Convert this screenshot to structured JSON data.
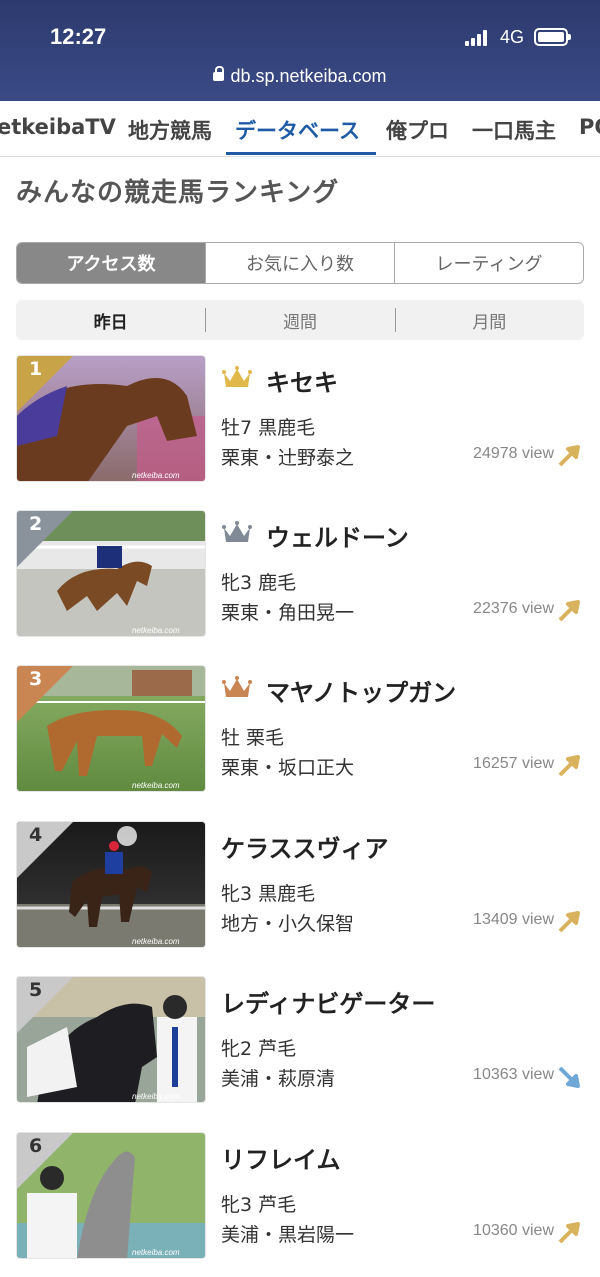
{
  "status": {
    "time": "12:27",
    "network": "4G"
  },
  "browser": {
    "url": "db.sp.netkeiba.com"
  },
  "nav": {
    "tabs": [
      {
        "label": "netkeibaTV"
      },
      {
        "label": "地方競馬"
      },
      {
        "label": "データベース"
      },
      {
        "label": "俺プロ"
      },
      {
        "label": "一口馬主"
      },
      {
        "label": "PO"
      }
    ],
    "active": "データベース"
  },
  "page": {
    "title": "みんなの競走馬ランキング"
  },
  "filters": {
    "metric": [
      "アクセス数",
      "お気に入り数",
      "レーティング"
    ],
    "metric_active": "アクセス数",
    "period": [
      "昨日",
      "週間",
      "月間"
    ],
    "period_active": "昨日"
  },
  "ranking": [
    {
      "rank": "1",
      "name": "キセキ",
      "sex_age_color": "牡7 黒鹿毛",
      "trainer": "栗東・辻野泰之",
      "views": "24978 view",
      "trend": "up",
      "crown": "gold",
      "rank_color": "#c9a347"
    },
    {
      "rank": "2",
      "name": "ウェルドーン",
      "sex_age_color": "牝3 鹿毛",
      "trainer": "栗東・角田晃一",
      "views": "22376 view",
      "trend": "up",
      "crown": "silver",
      "rank_color": "#8a929c"
    },
    {
      "rank": "3",
      "name": "マヤノトップガン",
      "sex_age_color": "牡 栗毛",
      "trainer": "栗東・坂口正大",
      "views": "16257 view",
      "trend": "up",
      "crown": "bronze",
      "rank_color": "#c98552"
    },
    {
      "rank": "4",
      "name": "ケラススヴィア",
      "sex_age_color": "牝3 黒鹿毛",
      "trainer": "地方・小久保智",
      "views": "13409 view",
      "trend": "up",
      "crown": "",
      "rank_color": "#c9c9c9"
    },
    {
      "rank": "5",
      "name": "レディナビゲーター",
      "sex_age_color": "牝2 芦毛",
      "trainer": "美浦・萩原清",
      "views": "10363 view",
      "trend": "down",
      "crown": "",
      "rank_color": "#c9c9c9"
    },
    {
      "rank": "6",
      "name": "リフレイム",
      "sex_age_color": "牝3 芦毛",
      "trainer": "美浦・黒岩陽一",
      "views": "10360 view",
      "trend": "up",
      "crown": "",
      "rank_color": "#c9c9c9"
    }
  ],
  "colors": {
    "accent": "#1f5aa6",
    "trend_up": "#d9b25e",
    "trend_down": "#6fa8d6"
  }
}
